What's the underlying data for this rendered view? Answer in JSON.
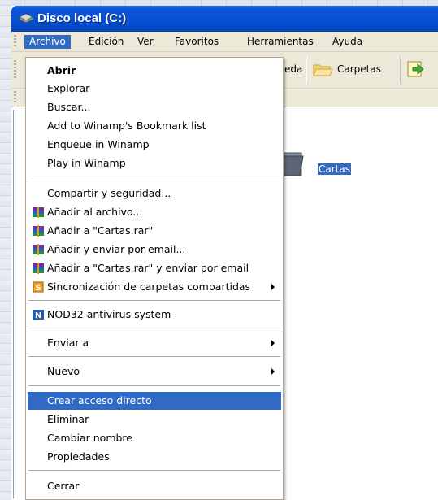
{
  "window": {
    "title": "Disco local (C:)"
  },
  "menubar": {
    "items": [
      "Archivo",
      "Edición",
      "Ver",
      "Favoritos",
      "Herramientas",
      "Ayuda"
    ],
    "active": "Archivo"
  },
  "toolbar": {
    "search_label_partial": "eda",
    "folders_label": "Carpetas"
  },
  "content": {
    "folder_name": "Cartas"
  },
  "file_menu": {
    "items": [
      {
        "label": "Abrir",
        "bold": true
      },
      {
        "label": "Explorar"
      },
      {
        "label": "Buscar..."
      },
      {
        "label": "Add to Winamp's Bookmark list"
      },
      {
        "label": "Enqueue in Winamp"
      },
      {
        "label": "Play in Winamp"
      },
      {
        "label": "Compartir y seguridad..."
      },
      {
        "label": "Añadir al archivo...",
        "icon": "winrar-icon"
      },
      {
        "label": "Añadir a \"Cartas.rar\"",
        "icon": "winrar-icon"
      },
      {
        "label": "Añadir y enviar por email...",
        "icon": "winrar-icon"
      },
      {
        "label": "Añadir a \"Cartas.rar\" y enviar por email",
        "icon": "winrar-icon"
      },
      {
        "label": "Sincronización de carpetas compartidas",
        "icon": "sync-icon",
        "submenu": true
      },
      {
        "label": "NOD32 antivirus system",
        "icon": "nod32-icon"
      },
      {
        "label": "Enviar a",
        "submenu": true
      },
      {
        "label": "Nuevo",
        "submenu": true
      },
      {
        "label": "Crear acceso directo",
        "selected": true
      },
      {
        "label": "Eliminar"
      },
      {
        "label": "Cambiar nombre"
      },
      {
        "label": "Propiedades"
      },
      {
        "label": "Cerrar"
      }
    ]
  },
  "colors": {
    "titlebar": "#0553d3",
    "selection": "#316ac5",
    "menubar": "#ece9d8"
  }
}
